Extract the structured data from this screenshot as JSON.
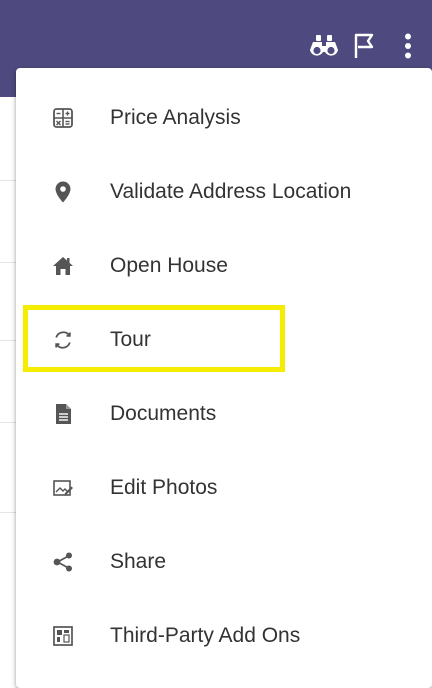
{
  "header": {
    "icons": [
      "binoculars-icon",
      "flag-icon",
      "more-vert-icon"
    ],
    "background_color": "#4e4a7f"
  },
  "menu": {
    "items": [
      {
        "label": "Price Analysis",
        "icon": "calculator-icon"
      },
      {
        "label": "Validate Address Location",
        "icon": "map-pin-icon"
      },
      {
        "label": "Open House",
        "icon": "house-icon"
      },
      {
        "label": "Tour",
        "icon": "refresh-icon"
      },
      {
        "label": "Documents",
        "icon": "document-icon"
      },
      {
        "label": "Edit Photos",
        "icon": "edit-photo-icon"
      },
      {
        "label": "Share",
        "icon": "share-icon"
      },
      {
        "label": "Third-Party Add Ons",
        "icon": "dashboard-icon"
      }
    ],
    "highlighted_item": "Tour",
    "highlight_color": "#f5ec00"
  }
}
